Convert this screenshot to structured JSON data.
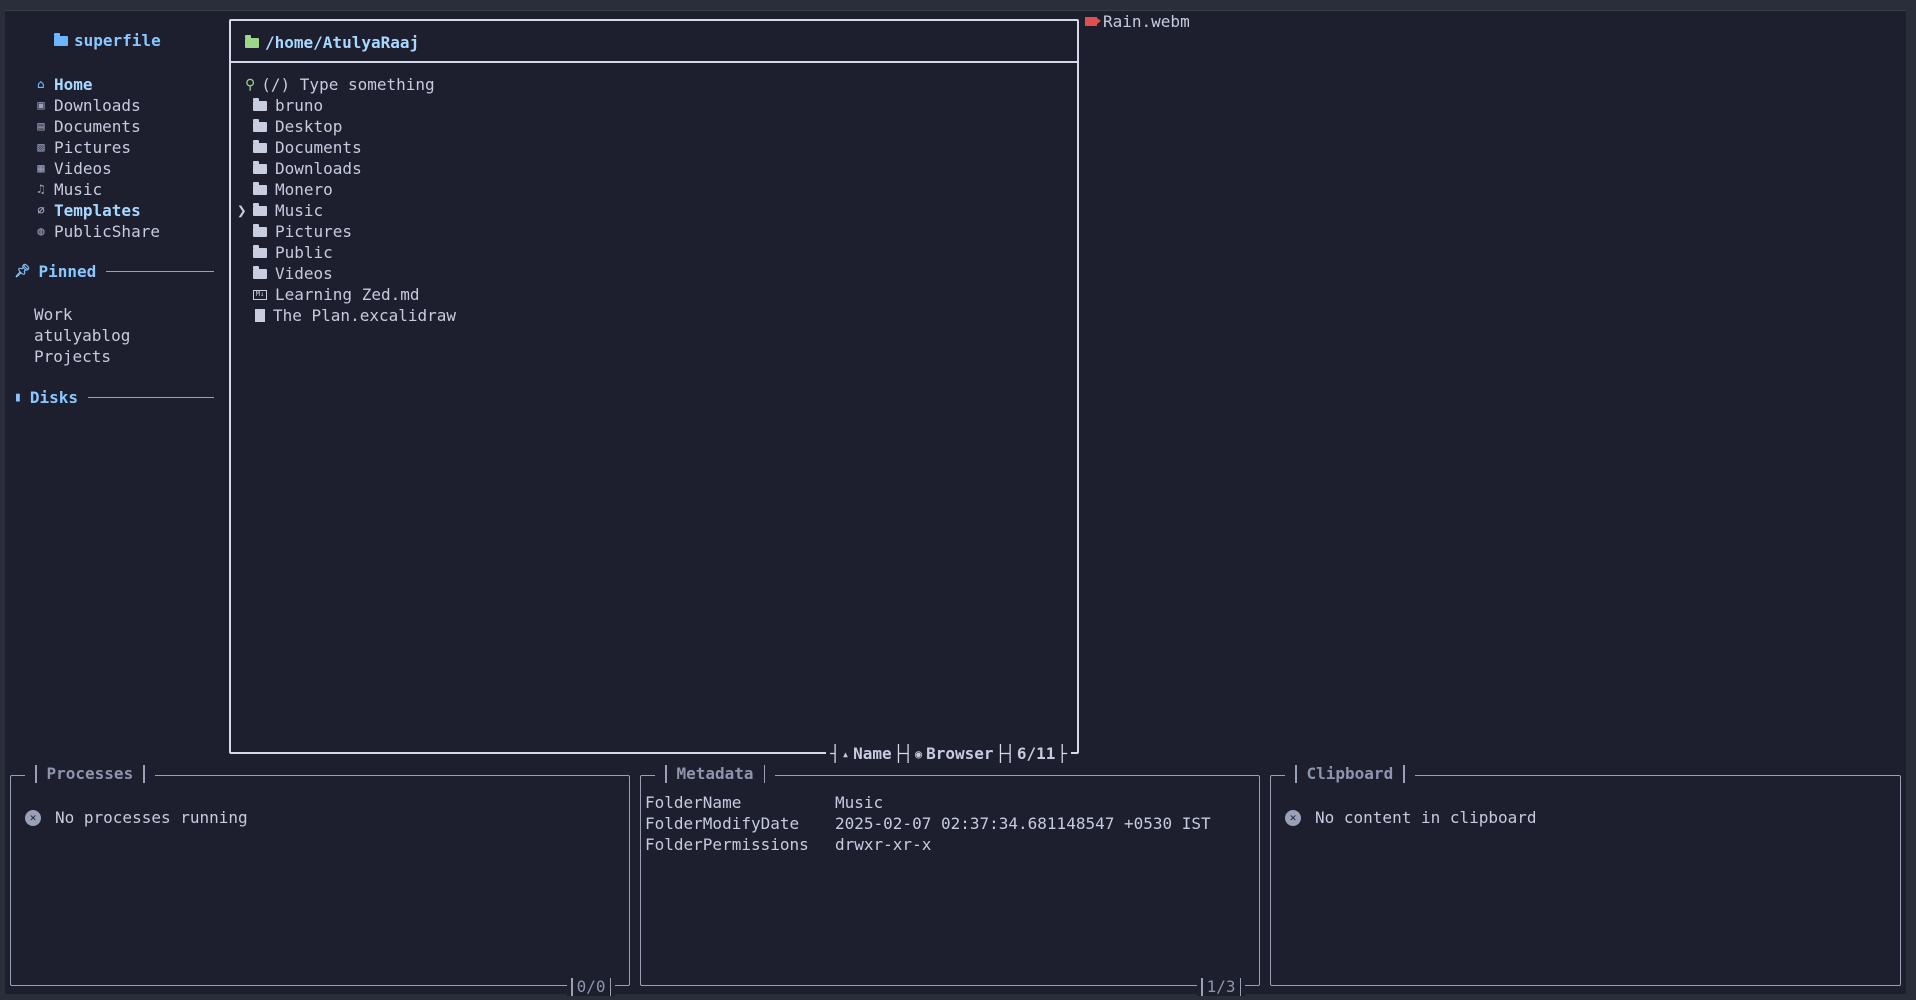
{
  "sidebar": {
    "title": "superfile",
    "well_known": [
      {
        "label": "Home",
        "icon": "home-icon",
        "active": true
      },
      {
        "label": "Downloads",
        "icon": "download-icon"
      },
      {
        "label": "Documents",
        "icon": "document-icon"
      },
      {
        "label": "Pictures",
        "icon": "picture-icon"
      },
      {
        "label": "Videos",
        "icon": "video-icon"
      },
      {
        "label": "Music",
        "icon": "music-icon"
      },
      {
        "label": "Templates",
        "icon": "template-icon",
        "active": true
      },
      {
        "label": "PublicShare",
        "icon": "globe-icon"
      }
    ],
    "pinned_label": "Pinned",
    "pinned": [
      "Work",
      "atulyablog",
      "Projects"
    ],
    "disks_label": "Disks"
  },
  "main": {
    "path": "/home/AtulyaRaaj",
    "search_placeholder": "(/) Type something",
    "files": [
      {
        "name": "bruno",
        "type": "folder"
      },
      {
        "name": "Desktop",
        "type": "folder"
      },
      {
        "name": "Documents",
        "type": "folder"
      },
      {
        "name": "Downloads",
        "type": "folder"
      },
      {
        "name": "Monero",
        "type": "folder"
      },
      {
        "name": "Music",
        "type": "folder",
        "selected": true
      },
      {
        "name": "Pictures",
        "type": "folder"
      },
      {
        "name": "Public",
        "type": "folder"
      },
      {
        "name": "Videos",
        "type": "folder"
      },
      {
        "name": "Learning Zed.md",
        "type": "markdown"
      },
      {
        "name": "The Plan.excalidraw",
        "type": "file"
      }
    ],
    "sort_label": "Name",
    "mode_label": "Browser",
    "position": "6/11"
  },
  "preview": {
    "filename": "Rain.webm"
  },
  "processes": {
    "title": "Processes",
    "message": "No processes running",
    "count": "0/0"
  },
  "metadata": {
    "title": "Metadata",
    "rows": [
      {
        "key": "FolderName",
        "value": "Music"
      },
      {
        "key": "FolderModifyDate",
        "value": "2025-02-07 02:37:34.681148547 +0530 IST"
      },
      {
        "key": "FolderPermissions",
        "value": "drwxr-xr-x"
      }
    ],
    "count": "1/3"
  },
  "clipboard": {
    "title": "Clipboard",
    "message": "No content in clipboard"
  },
  "colors": {
    "background": "#1e1f2e",
    "accent": "#88c7ff",
    "border": "#d4d9ee",
    "success": "#9ed68a",
    "record": "#e04f4f"
  }
}
